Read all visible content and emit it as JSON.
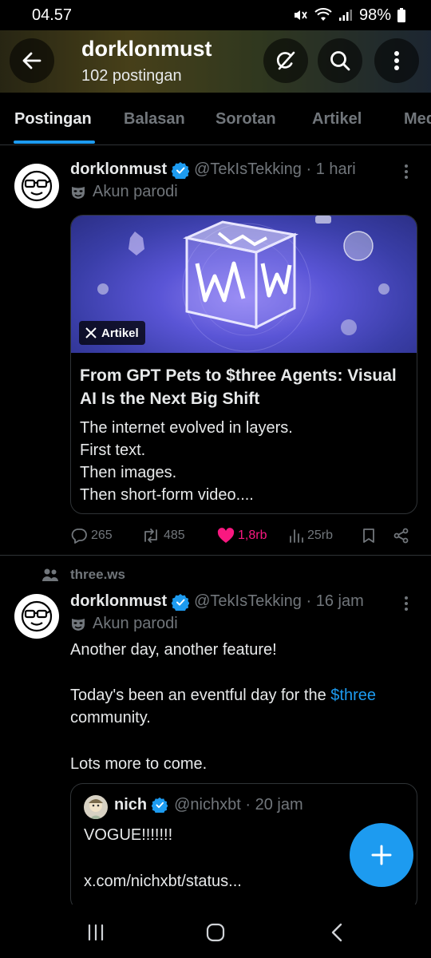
{
  "status_bar": {
    "time": "04.57",
    "battery": "98%"
  },
  "header": {
    "name": "dorklonmust",
    "post_count": "102 postingan"
  },
  "tabs": [
    {
      "label": "Postingan",
      "active": true
    },
    {
      "label": "Balasan"
    },
    {
      "label": "Sorotan"
    },
    {
      "label": "Artikel"
    },
    {
      "label": "Med"
    }
  ],
  "tweet1": {
    "name": "dorklonmust",
    "handle_time": "@TekIsTekking · 1 hari",
    "parody_label": "Akun parodi",
    "article": {
      "badge": "Artikel",
      "title": "From GPT Pets to $three Agents: Visual AI Is the Next Big Shift",
      "body_lines": [
        "The internet evolved in layers.",
        "First text.",
        "Then images.",
        "Then short-form video...."
      ]
    },
    "actions": {
      "replies": "265",
      "reposts": "485",
      "likes": "1,8rb",
      "views": "25rb"
    }
  },
  "tweet2": {
    "community": "three.ws",
    "name": "dorklonmust",
    "handle_time": "@TekIsTekking · 16 jam",
    "parody_label": "Akun parodi",
    "line1": "Another day, another feature!",
    "line2_prefix": "Today's been an eventful day for the ",
    "line2_link": "$three",
    "line3": "community.",
    "line4": "Lots more to come.",
    "quote": {
      "name": "nich",
      "handle_time": "@nichxbt · 20 jam",
      "text": "VOGUE!!!!!!!",
      "link": "x.com/nichxbt/status..."
    }
  },
  "colors": {
    "accent": "#1d9bf0",
    "like": "#f91880",
    "muted": "#71767b",
    "text": "#e7e9ea",
    "border": "#2f3336"
  },
  "icons": [
    "back-arrow-icon",
    "grok-icon",
    "search-icon",
    "more-vertical-icon",
    "verified-icon",
    "parody-mask-icon",
    "reply-icon",
    "repost-icon",
    "heart-icon",
    "views-icon",
    "bookmark-icon",
    "share-icon",
    "community-icon",
    "plus-icon"
  ]
}
